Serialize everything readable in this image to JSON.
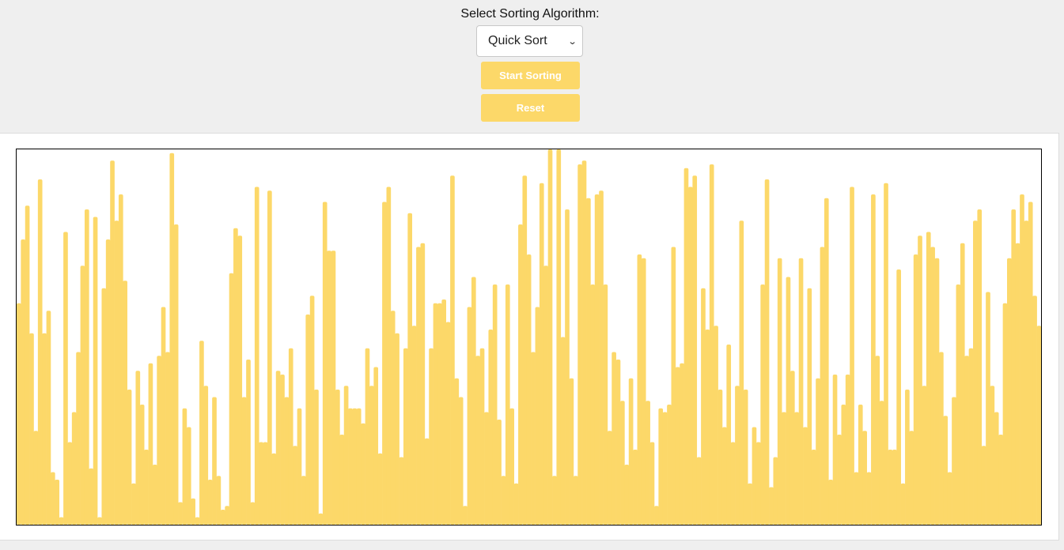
{
  "controls": {
    "select_label": "Select Sorting Algorithm:",
    "selected_algorithm": "Quick Sort",
    "start_label": "Start Sorting",
    "reset_label": "Reset"
  },
  "colors": {
    "bar": "#fcd869",
    "button": "#fcd869",
    "page_background": "#efefef",
    "canvas_background": "#ffffff"
  },
  "array": {
    "max_value": 100,
    "values": [
      59,
      76,
      85,
      51,
      25,
      92,
      51,
      57,
      14,
      12,
      2,
      78,
      22,
      30,
      46,
      69,
      84,
      15,
      82,
      2,
      63,
      76,
      97,
      81,
      88,
      65,
      36,
      11,
      41,
      32,
      20,
      43,
      16,
      45,
      58,
      46,
      99,
      80,
      6,
      31,
      26,
      7,
      2,
      49,
      37,
      12,
      34,
      13,
      4,
      5,
      67,
      79,
      77,
      34,
      44,
      6,
      90,
      22,
      22,
      89,
      19,
      41,
      40,
      34,
      47,
      21,
      31,
      13,
      56,
      61,
      36,
      3,
      86,
      73,
      73,
      36,
      24,
      37,
      31,
      31,
      31,
      27,
      47,
      37,
      42,
      19,
      86,
      90,
      57,
      51,
      18,
      47,
      83,
      53,
      74,
      75,
      23,
      47,
      59,
      59,
      60,
      54,
      93,
      39,
      34,
      5,
      58,
      66,
      45,
      47,
      30,
      52,
      64,
      28,
      13,
      64,
      31,
      11,
      80,
      93,
      72,
      46,
      58,
      91,
      69,
      100,
      13,
      100,
      50,
      84,
      39,
      13,
      96,
      97,
      87,
      64,
      88,
      89,
      64,
      25,
      46,
      44,
      33,
      16,
      39,
      20,
      72,
      71,
      33,
      22,
      5,
      31,
      30,
      32,
      74,
      42,
      43,
      95,
      90,
      93,
      18,
      63,
      52,
      96,
      53,
      36,
      26,
      48,
      22,
      37,
      81,
      36,
      11,
      26,
      22,
      64,
      92,
      10,
      18,
      71,
      30,
      66,
      41,
      30,
      71,
      26,
      63,
      20,
      39,
      74,
      87,
      12,
      40,
      24,
      32,
      40,
      90,
      14,
      32,
      25,
      14,
      88,
      45,
      33,
      91,
      20,
      20,
      68,
      11,
      36,
      25,
      72,
      77,
      37,
      78,
      74,
      71,
      46,
      29,
      14,
      34,
      64,
      75,
      45,
      47,
      81,
      84,
      21,
      62,
      37,
      30,
      24,
      59,
      71,
      84,
      75,
      88,
      81,
      86,
      61,
      53
    ]
  }
}
